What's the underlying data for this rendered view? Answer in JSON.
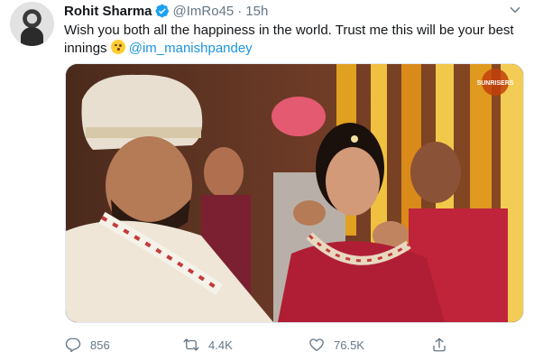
{
  "tweet": {
    "author_name": "Rohit Sharma",
    "handle": "@ImRo45",
    "separator": "·",
    "time": "15h",
    "text_line1": "Wish you both all the happiness in the world. Trust me this will be your best",
    "text_line2_prefix": "innings",
    "mention": "@im_manishpandey",
    "photo_watermark": "SUNRISERS",
    "stats": {
      "replies": "856",
      "retweets": "4.4K",
      "likes": "76.5K"
    }
  },
  "colors": {
    "link": "#1b95e0",
    "text": "#14171a",
    "muted": "#657786",
    "verified": "#1da1f2"
  },
  "icons": {
    "verified": "verified-badge-icon",
    "more": "chevron-down-icon",
    "reply": "reply-icon",
    "retweet": "retweet-icon",
    "like": "heart-icon",
    "share": "share-icon",
    "emoji": "winking-face-emoji"
  }
}
